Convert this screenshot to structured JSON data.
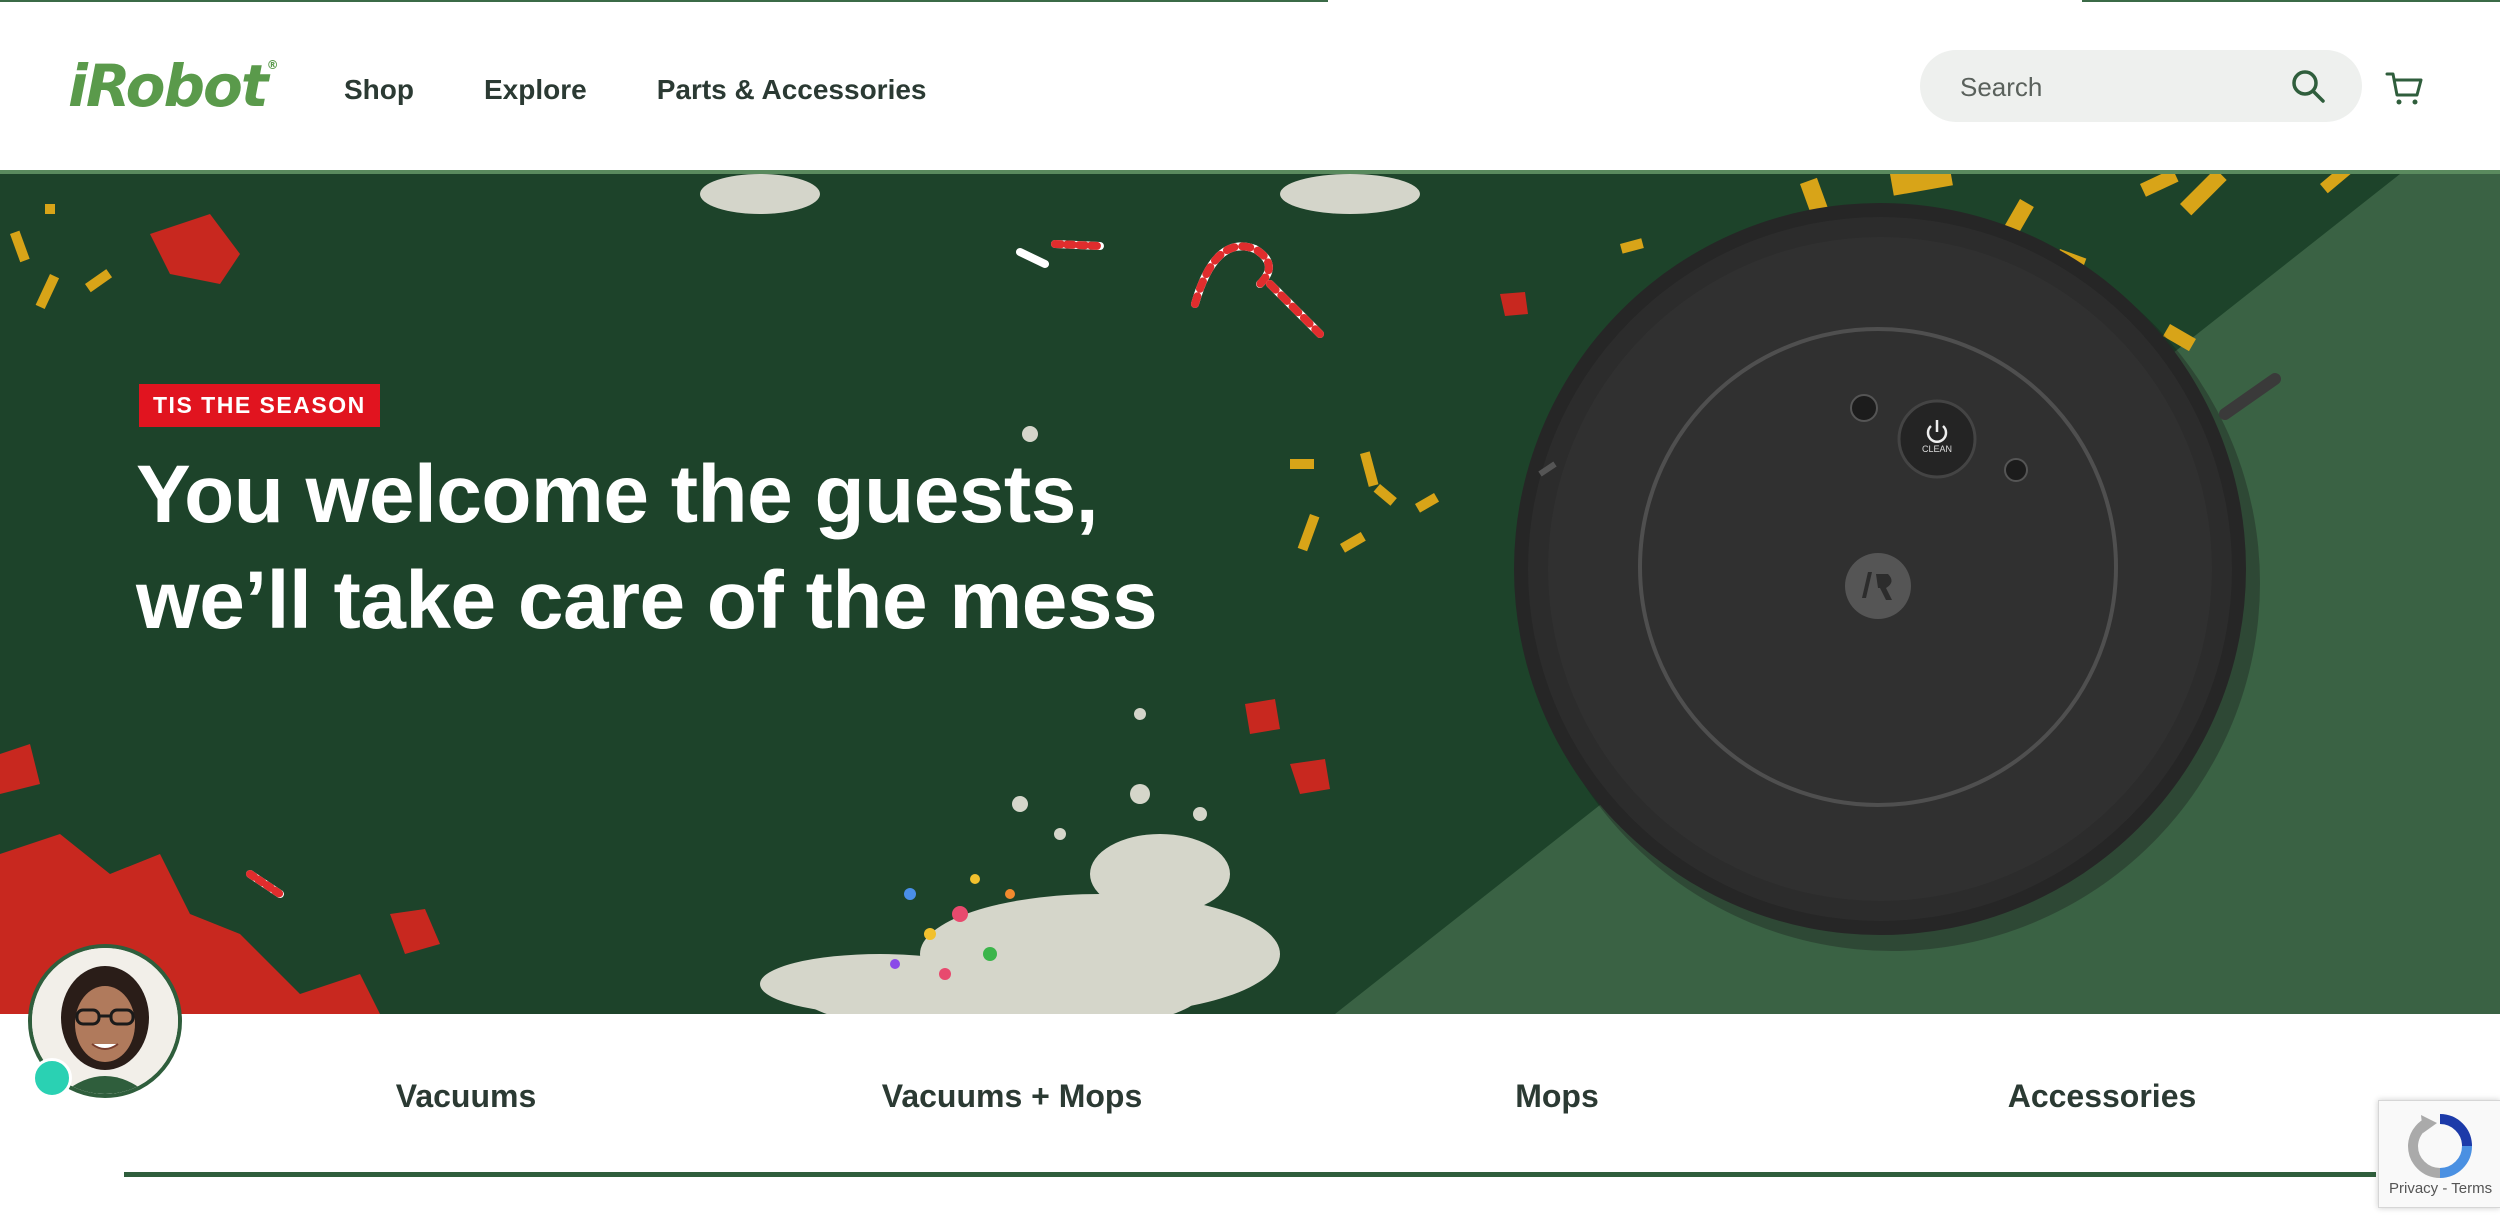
{
  "header": {
    "logo": "iRobot",
    "nav": [
      "Shop",
      "Explore",
      "Parts & Accessories"
    ],
    "search": {
      "placeholder": "Search"
    }
  },
  "hero": {
    "badge": "TIS THE SEASON",
    "headline": "You welcome the guests, we’ll take care of the mess",
    "robot_button": "CLEAN"
  },
  "categories": [
    "Vacuums",
    "Vacuums + Mops",
    "Mops",
    "Accessories"
  ],
  "recaptcha": {
    "links": "Privacy - Terms"
  },
  "colors": {
    "brand_green": "#5a9a4b",
    "hero_dark": "#1d432a",
    "hero_light": "#3a6244",
    "badge_red": "#e1141f",
    "underline": "#2f5e3c"
  },
  "icons": [
    "search-icon",
    "cart-icon",
    "robot-vacuum",
    "chat-avatar",
    "recaptcha-icon"
  ]
}
